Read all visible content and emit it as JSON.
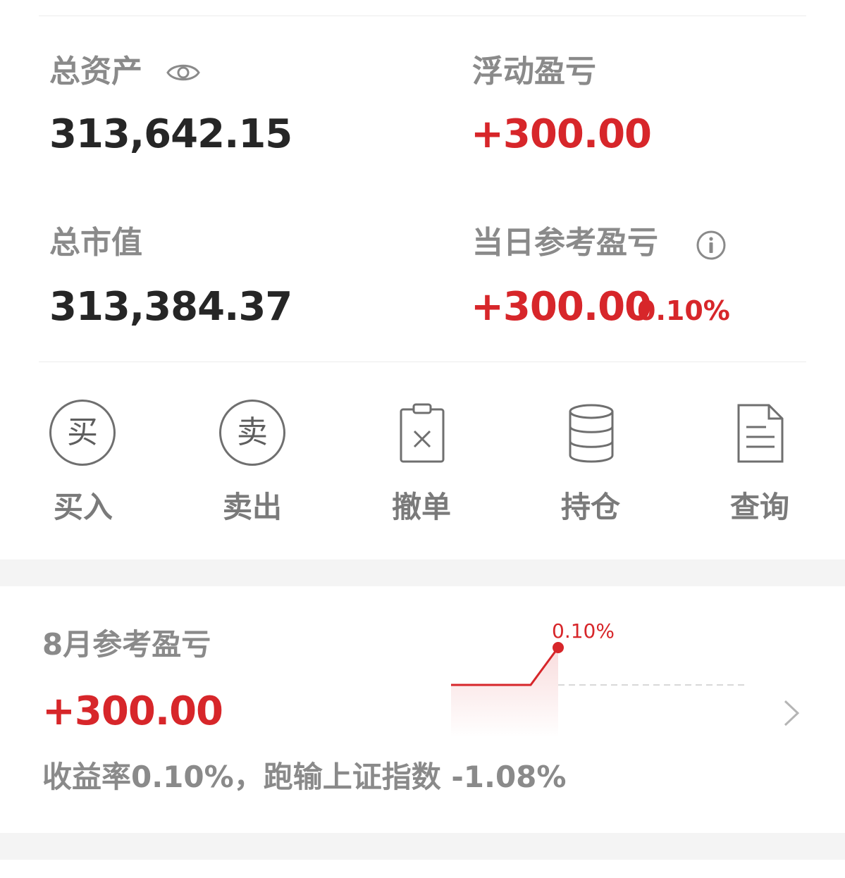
{
  "assets": {
    "total_assets_label": "总资产",
    "total_assets_value": "313,642.15",
    "floating_pl_label": "浮动盈亏",
    "floating_pl_value": "+300.00",
    "market_value_label": "总市值",
    "market_value_value": "313,384.37",
    "daily_pl_label": "当日参考盈亏",
    "daily_pl_value": "+300.00",
    "daily_pl_pct": "0.10%"
  },
  "actions": [
    {
      "icon_text": "买",
      "label": "买入",
      "icon": "buy-icon"
    },
    {
      "icon_text": "卖",
      "label": "卖出",
      "icon": "sell-icon"
    },
    {
      "label": "撤单",
      "icon": "cancel-order-icon"
    },
    {
      "label": "持仓",
      "icon": "positions-icon"
    },
    {
      "label": "查询",
      "icon": "query-icon"
    }
  ],
  "monthly": {
    "title": "8月参考盈亏",
    "value": "+300.00",
    "summary": "收益率0.10%，跑输上证指数 -1.08%",
    "chart_label": "0.10%"
  },
  "colors": {
    "accent_red": "#d7262a",
    "text_dark": "#262626",
    "text_gray": "#8a8a8a"
  }
}
